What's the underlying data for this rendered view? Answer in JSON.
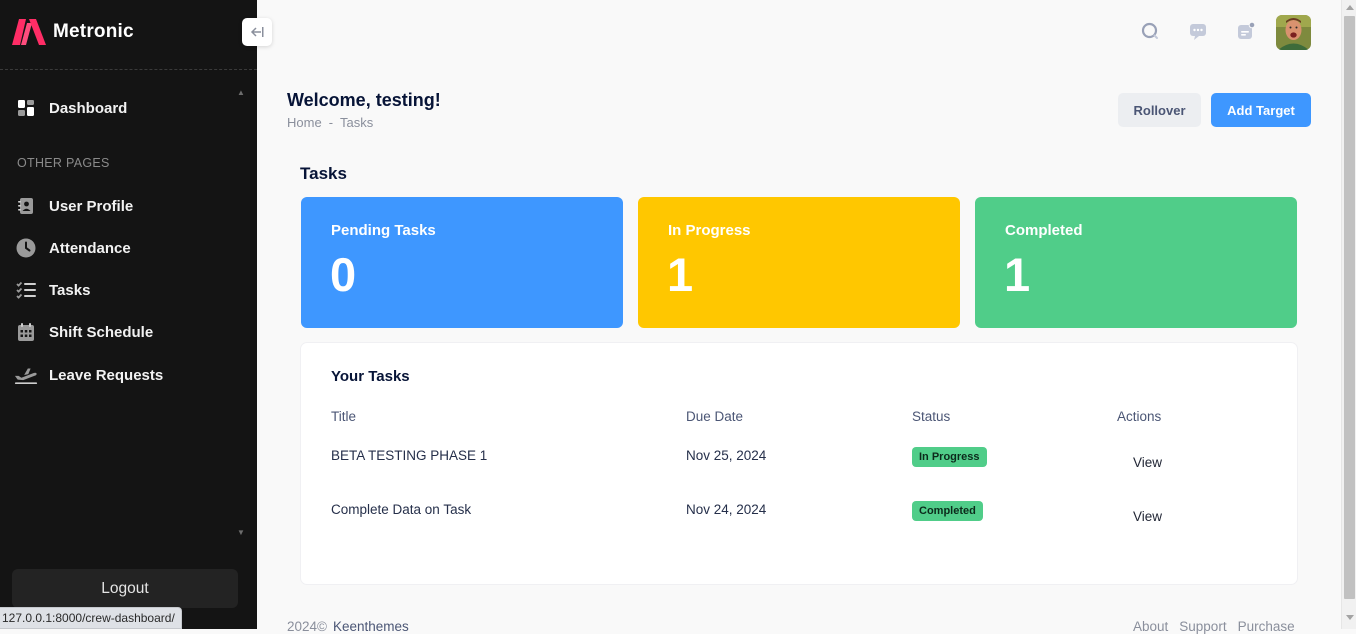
{
  "app": {
    "brand_name": "Metronic",
    "status_url": "127.0.0.1:8000/crew-dashboard/"
  },
  "sidebar": {
    "items": [
      {
        "label": "Dashboard",
        "icon": "dashboard-grid-icon"
      }
    ],
    "section_title": "OTHER PAGES",
    "other_items": [
      {
        "label": "User Profile",
        "icon": "user-profile-icon"
      },
      {
        "label": "Attendance",
        "icon": "clock-icon"
      },
      {
        "label": "Tasks",
        "icon": "task-list-icon"
      },
      {
        "label": "Shift Schedule",
        "icon": "calendar-icon"
      },
      {
        "label": "Leave Requests",
        "icon": "airplane-icon"
      }
    ],
    "logout_label": "Logout"
  },
  "header": {
    "icons": [
      "search-icon",
      "chat-icon",
      "notifications-icon"
    ],
    "avatar": "user-avatar"
  },
  "page": {
    "title": "Welcome, testing!",
    "breadcrumb": [
      "Home",
      "-",
      "Tasks"
    ],
    "actions": {
      "rollover_label": "Rollover",
      "add_target_label": "Add Target"
    },
    "section_heading": "Tasks"
  },
  "stats": [
    {
      "label": "Pending Tasks",
      "value": "0",
      "color": "#3e97ff"
    },
    {
      "label": "In Progress",
      "value": "1",
      "color": "#ffc700"
    },
    {
      "label": "Completed",
      "value": "1",
      "color": "#50cd89"
    }
  ],
  "tasks_table": {
    "title": "Your Tasks",
    "columns": [
      "Title",
      "Due Date",
      "Status",
      "Actions"
    ],
    "rows": [
      {
        "title": "BETA TESTING PHASE 1",
        "due_date": "Nov 25, 2024",
        "status": "In Progress",
        "action": "View"
      },
      {
        "title": "Complete Data on Task",
        "due_date": "Nov 24, 2024",
        "status": "Completed",
        "action": "View"
      }
    ]
  },
  "footer": {
    "copyright": "2024©",
    "company": "Keenthemes",
    "links": [
      "About",
      "Support",
      "Purchase"
    ]
  },
  "colors": {
    "sidebar_bg": "#141414",
    "primary": "#3e97ff",
    "warning": "#ffc700",
    "success": "#50cd89"
  }
}
